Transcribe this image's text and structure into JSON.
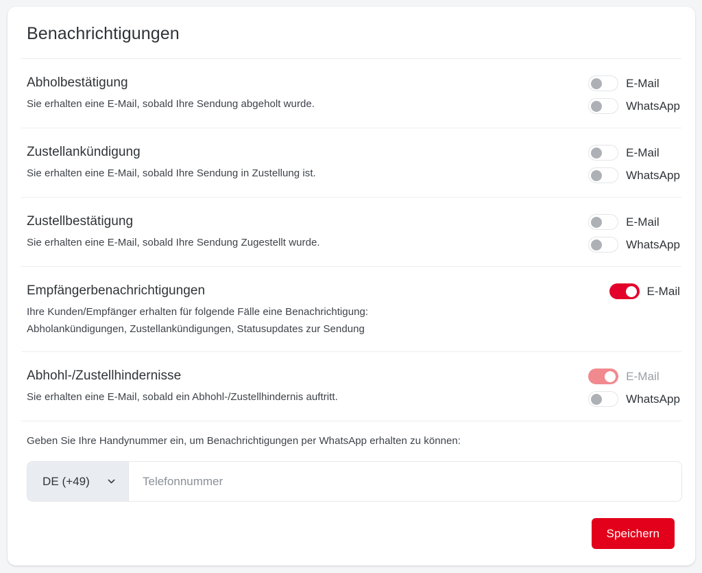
{
  "card": {
    "title": "Benachrichtigungen"
  },
  "notifications": [
    {
      "title": "Abholbestätigung",
      "description": "Sie erhalten eine E-Mail, sobald Ihre Sendung abgeholt wurde.",
      "controls": [
        {
          "label": "E-Mail",
          "state": "off",
          "disabled": false
        },
        {
          "label": "WhatsApp",
          "state": "off",
          "disabled": false
        }
      ]
    },
    {
      "title": "Zustellankündigung",
      "description": "Sie erhalten eine E-Mail, sobald Ihre Sendung in Zustellung ist.",
      "controls": [
        {
          "label": "E-Mail",
          "state": "off",
          "disabled": false
        },
        {
          "label": "WhatsApp",
          "state": "off",
          "disabled": false
        }
      ]
    },
    {
      "title": "Zustellbestätigung",
      "description": "Sie erhalten eine E-Mail, sobald Ihre Sendung Zugestellt wurde.",
      "controls": [
        {
          "label": "E-Mail",
          "state": "off",
          "disabled": false
        },
        {
          "label": "WhatsApp",
          "state": "off",
          "disabled": false
        }
      ]
    },
    {
      "title": "Empfängerbenachrichtigungen",
      "description": "Ihre Kunden/Empfänger erhalten für folgende Fälle eine Benachrichtigung:",
      "description2": "Abholankündigungen, Zustellankündigungen, Statusupdates zur Sendung",
      "controls": [
        {
          "label": "E-Mail",
          "state": "on",
          "disabled": false
        }
      ]
    },
    {
      "title": "Abhohl-/Zustellhindernisse",
      "description": "Sie erhalten eine E-Mail, sobald ein Abhohl-/Zustellhindernis auftritt.",
      "controls": [
        {
          "label": "E-Mail",
          "state": "on",
          "disabled": true
        },
        {
          "label": "WhatsApp",
          "state": "off",
          "disabled": false
        }
      ]
    }
  ],
  "phone": {
    "hint": "Geben Sie Ihre Handynummer ein, um Benachrichtigungen per WhatsApp erhalten zu können:",
    "country_value": "DE (+49)",
    "country_icon": "chevron-down-icon",
    "input_placeholder": "Telefonnummer",
    "input_value": ""
  },
  "footer": {
    "save_label": "Speichern"
  },
  "colors": {
    "accent_red": "#E2001A",
    "toggle_on": "#E3002B",
    "toggle_on_disabled": "#F08A8F",
    "page_background": "#F4F5F7",
    "card_background": "#FFFFFF",
    "divider": "#ECEDEF",
    "country_background": "#E9EDF1"
  }
}
